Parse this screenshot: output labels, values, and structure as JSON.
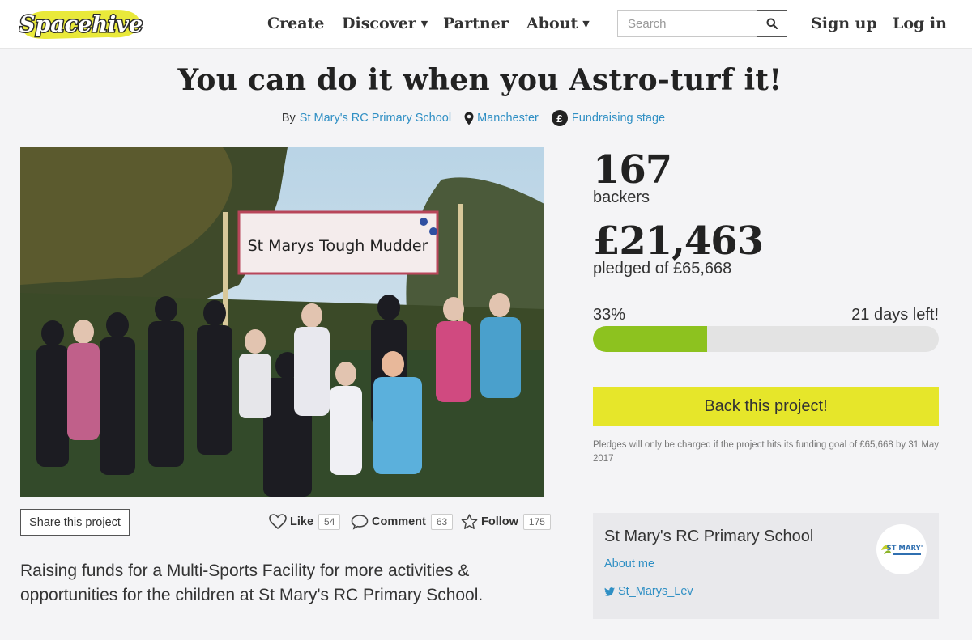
{
  "header": {
    "logo_text": "Spacehive",
    "nav": {
      "create": "Create",
      "discover": "Discover",
      "partner": "Partner",
      "about": "About"
    },
    "search_placeholder": "Search",
    "sign_up": "Sign up",
    "log_in": "Log in"
  },
  "project": {
    "title": "You can do it when you Astro-turf it!",
    "by_label": "By",
    "creator": "St Mary's RC Primary School",
    "location": "Manchester",
    "stage": "Fundraising stage",
    "banner_text": "St Marys Tough Mudder",
    "description": "Raising funds for a Multi-Sports Facility for more activities & opportunities for the children at St Mary's RC Primary School."
  },
  "actions": {
    "share": "Share this project",
    "like_label": "Like",
    "like_count": "54",
    "comment_label": "Comment",
    "comment_count": "63",
    "follow_label": "Follow",
    "follow_count": "175"
  },
  "stats": {
    "backers": "167",
    "backers_label": "backers",
    "pledged": "£21,463",
    "pledged_label": "pledged of £65,668",
    "percent": "33%",
    "progress_fraction": 0.33,
    "days_left": "21 days left!",
    "back_button": "Back this project!",
    "note": "Pledges will only be charged if the project hits its funding goal of £65,668 by 31 May 2017"
  },
  "owner": {
    "name": "St Mary's RC Primary School",
    "about": "About me",
    "twitter": "St_Marys_Lev",
    "logo_text": "ST MARY'S"
  },
  "colors": {
    "accent_link": "#2f8fc4",
    "progress": "#8dc21f",
    "back_button": "#e6e62a",
    "logo_yellow": "#e9e93a"
  },
  "icons": {
    "search": "magnifier-icon",
    "location": "map-pin-icon",
    "stage": "pound-circle-icon",
    "like": "heart-icon",
    "comment": "speech-bubble-icon",
    "follow": "star-icon",
    "twitter": "twitter-bird-icon"
  }
}
